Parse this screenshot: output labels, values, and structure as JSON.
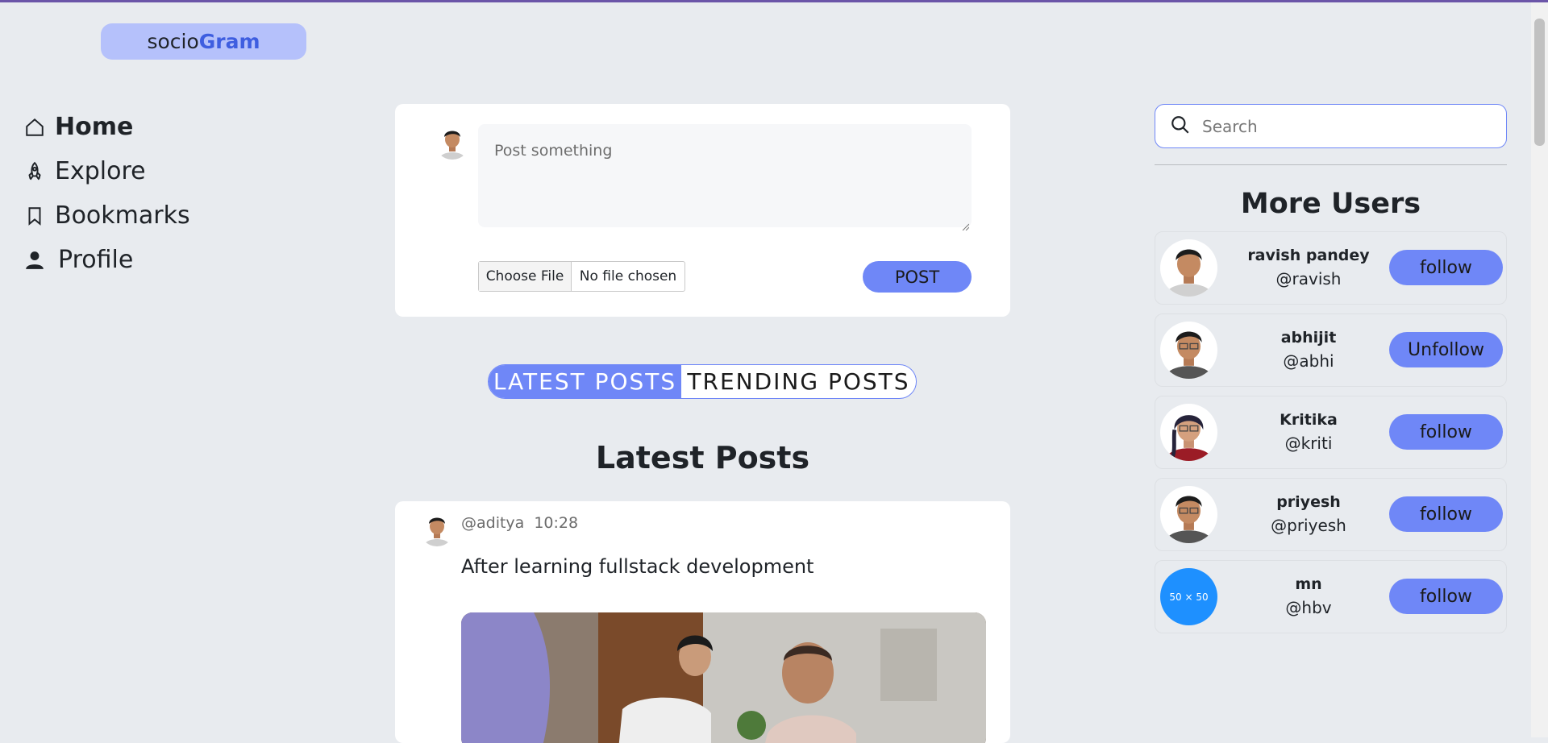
{
  "brand": {
    "part1": "socio",
    "part2": "Gram",
    "accent": "#3e5ee0"
  },
  "nav": {
    "items": [
      {
        "label": "Home",
        "icon": "home-icon",
        "active": true
      },
      {
        "label": "Explore",
        "icon": "rocket-icon",
        "active": false
      },
      {
        "label": "Bookmarks",
        "icon": "bookmark-icon",
        "active": false
      },
      {
        "label": "Profile",
        "icon": "user-icon",
        "active": false
      }
    ]
  },
  "composer": {
    "placeholder": "Post something",
    "file_button": "Choose File",
    "file_status": "No file chosen",
    "post_button": "POST"
  },
  "tabs": [
    {
      "label": "LATEST POSTS",
      "active": true
    },
    {
      "label": "TRENDING POSTS",
      "active": false
    }
  ],
  "feed": {
    "title": "Latest Posts",
    "posts": [
      {
        "handle": "@aditya",
        "time": "10:28",
        "text": "After learning fullstack development"
      }
    ]
  },
  "search": {
    "placeholder": "Search"
  },
  "more_users": {
    "title": "More Users",
    "users": [
      {
        "name": "ravish pandey",
        "handle": "@ravish",
        "action": "follow",
        "avatar": "avatar-male"
      },
      {
        "name": "abhijit",
        "handle": "@abhi",
        "action": "Unfollow",
        "avatar": "avatar-male-glasses"
      },
      {
        "name": "Kritika",
        "handle": "@kriti",
        "action": "follow",
        "avatar": "avatar-female"
      },
      {
        "name": "priyesh",
        "handle": "@priyesh",
        "action": "follow",
        "avatar": "avatar-male-glasses"
      },
      {
        "name": "mn",
        "handle": "@hbv",
        "action": "follow",
        "avatar": "placeholder",
        "avatar_text": "50 × 50"
      }
    ]
  },
  "colors": {
    "button": "#6f87f7",
    "logo_bg": "#b5c1fb",
    "page_bg": "#e8ebef"
  }
}
